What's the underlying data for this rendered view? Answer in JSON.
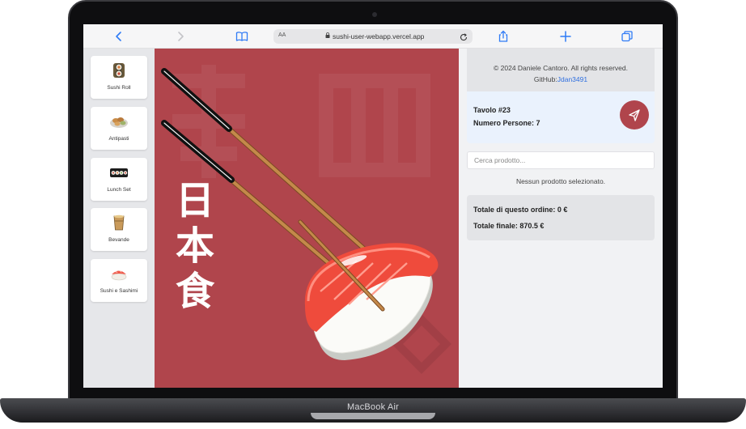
{
  "device": {
    "label": "MacBook Air"
  },
  "browser": {
    "text_size_label": "AA",
    "url": "sushi-user-webapp.vercel.app"
  },
  "categories": [
    {
      "label": "Sushi Roll",
      "icon": "sushi-roll-icon"
    },
    {
      "label": "Antipasti",
      "icon": "antipasti-icon"
    },
    {
      "label": "Lunch Set",
      "icon": "lunch-set-icon"
    },
    {
      "label": "Bevande",
      "icon": "bevande-icon"
    },
    {
      "label": "Sushi e Sashimi",
      "icon": "sushi-sashimi-icon"
    }
  ],
  "hero": {
    "kanji": [
      "日",
      "本",
      "食"
    ]
  },
  "footer": {
    "copyright": "© 2024 Daniele Cantoro. All rights reserved.",
    "github_prefix": "GitHub:",
    "github_handle": "Jdan3491"
  },
  "table": {
    "number_label": "Tavolo #23",
    "people_label": "Numero Persone: 7"
  },
  "search": {
    "placeholder": "Cerca prodotto..."
  },
  "cart": {
    "empty_message": "Nessun prodotto selezionato."
  },
  "totals": {
    "order_label": "Totale di questo ordine: 0 €",
    "final_label": "Totale finale: 870.5 €"
  },
  "colors": {
    "accent": "#b0454c",
    "link": "#2f6fe0",
    "browser_blue": "#2f7bf6"
  }
}
